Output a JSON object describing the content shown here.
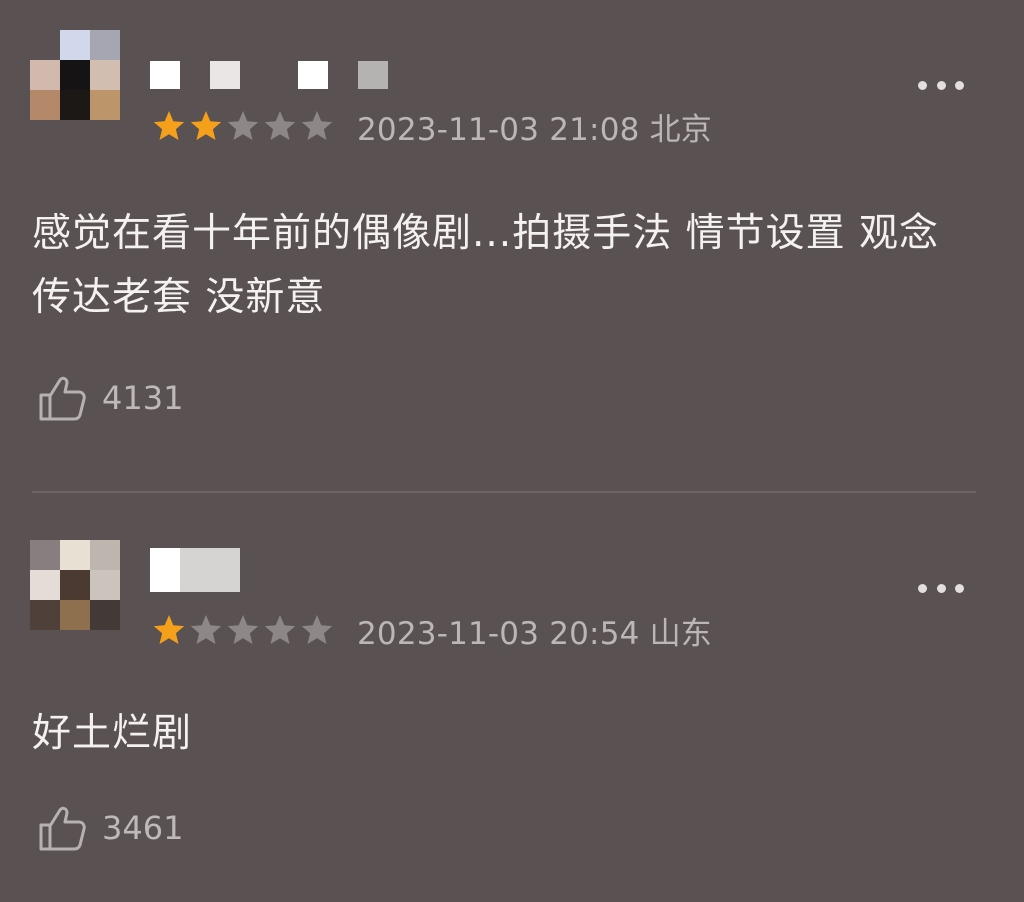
{
  "colors": {
    "background": "#5a5152",
    "star_on": "#f4a01a",
    "star_off": "#8d8788",
    "meta_text": "#bcb6b6",
    "content_text": "#f4f1f1"
  },
  "reviews": [
    {
      "avatar_pixels": [
        "#5a5152",
        "#d2d8ec",
        "#a6a6b3",
        "#d2b9ad",
        "#151314",
        "#d2bdb1",
        "#b3896a",
        "#1b1816",
        "#bc956b"
      ],
      "username_blocks": [
        "#ffffff",
        "#eae6e6",
        "#ffffff",
        "#b5b2b2"
      ],
      "rating": 2,
      "max_rating": 5,
      "timestamp": "2023-11-03 21:08 北京",
      "text": "感觉在看十年前的偶像剧...拍摄手法 情节设置 观念传达老套 没新意",
      "likes": "4131",
      "more_icon": "more-horizontal-icon",
      "like_icon": "thumbs-up-icon"
    },
    {
      "avatar_pixels": [
        "#867e7f",
        "#e8e0d3",
        "#bdb6af",
        "#e4dcd6",
        "#4b3a31",
        "#cbc4bd",
        "#4f4139",
        "#8e704f",
        "#433a37"
      ],
      "username_blocks": [
        "#ffffff",
        "#d6d3d3"
      ],
      "rating": 1,
      "max_rating": 5,
      "timestamp": "2023-11-03 20:54 山东",
      "text": "好土烂剧",
      "likes": "3461",
      "more_icon": "more-horizontal-icon",
      "like_icon": "thumbs-up-icon"
    }
  ]
}
